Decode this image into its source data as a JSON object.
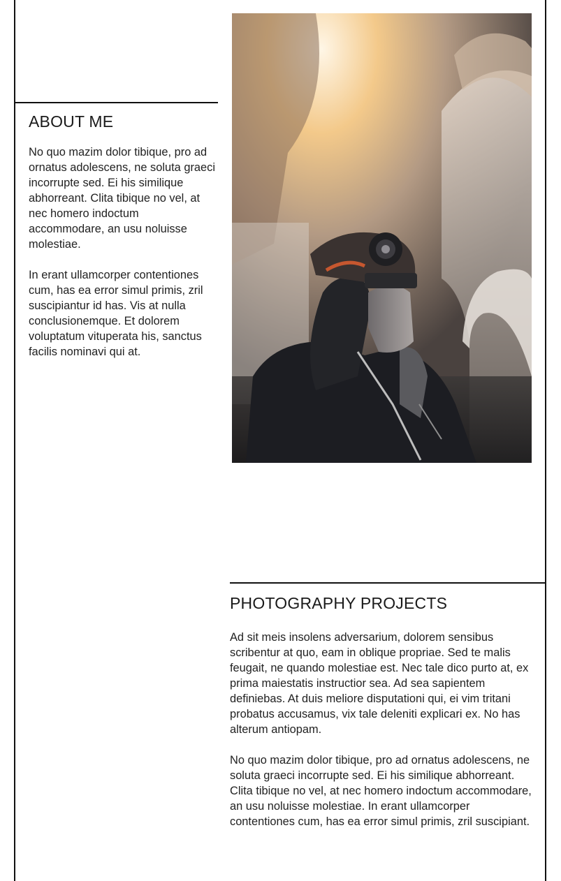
{
  "about": {
    "title": "ABOUT ME",
    "paragraphs": [
      "No quo mazim dolor tibique, pro ad ornatus adolescens, ne soluta graeci incorrupte sed. Ei his similique abhorreant. Clita tibique no vel, at nec homero indoctum accommodare, an usu noluisse molestiae.",
      "In erant ullamcorper contentiones cum, has ea error simul primis, zril suscipiantur id has. Vis at nulla conclusionemque. Et dolorem voluptatum vituperata his, sanctus facilis nominavi qui at."
    ]
  },
  "hero": {
    "icon": "photo-of-man-with-camera-goggles"
  },
  "projects": {
    "title": "PHOTOGRAPHY PROJECTS",
    "paragraphs": [
      "Ad sit meis insolens adversarium, dolorem sensibus scribentur at quo, eam in oblique propriae. Sed te malis feugait, ne quando molestiae est. Nec tale dico purto at, ex prima maiestatis instructior sea. Ad sea sapientem definiebas. At duis meliore disputationi qui, ei vim tritani probatus accusamus, vix tale deleniti explicari ex. No has alterum antiopam.",
      "No quo mazim dolor tibique, pro ad ornatus adolescens, ne soluta graeci incorrupte sed. Ei his similique abhorreant. Clita tibique no vel, at nec homero indoctum accommodare, an usu noluisse molestiae. In erant ullamcorper contentiones cum, has ea error simul primis, zril suscipiant."
    ]
  },
  "colors": {
    "rule": "#111111",
    "text": "#222222",
    "warm_light": "#f3c98a",
    "jacket": "#1c1d22"
  }
}
